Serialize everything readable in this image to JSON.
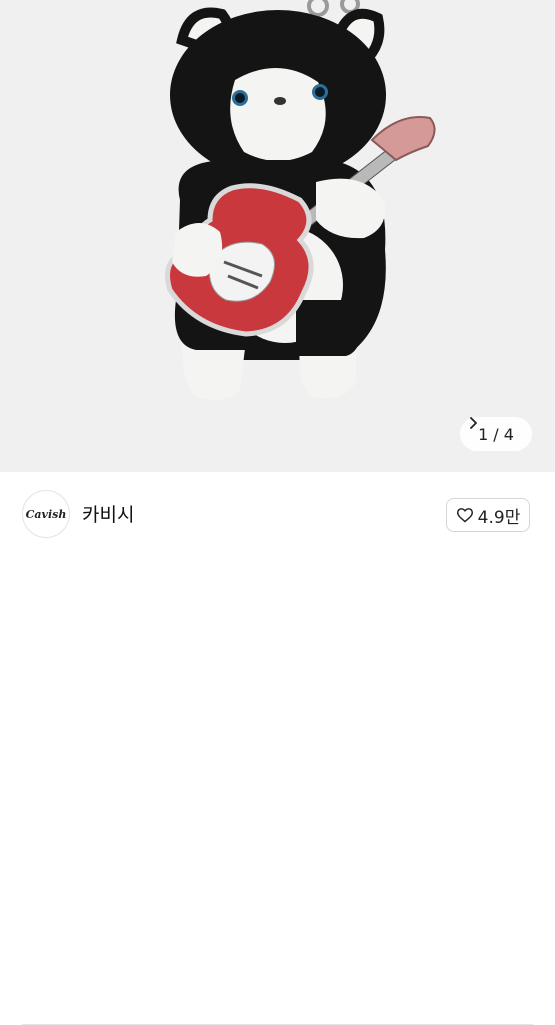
{
  "product": {
    "image_alt": "black and white cat plush keychain holding a red electric guitar",
    "image_counter": {
      "current": "1",
      "separator": "/",
      "total": "4"
    }
  },
  "seller": {
    "logo_text": "Cavish",
    "name": "카비시"
  },
  "like": {
    "count": "4.9만",
    "icon": "heart-outline-icon"
  },
  "colors": {
    "image_bg": "#f0f0f1",
    "plush_black": "#141414",
    "plush_white": "#f4f4f2",
    "guitar_red": "#c9383d",
    "headstock_pink": "#d59a97"
  }
}
